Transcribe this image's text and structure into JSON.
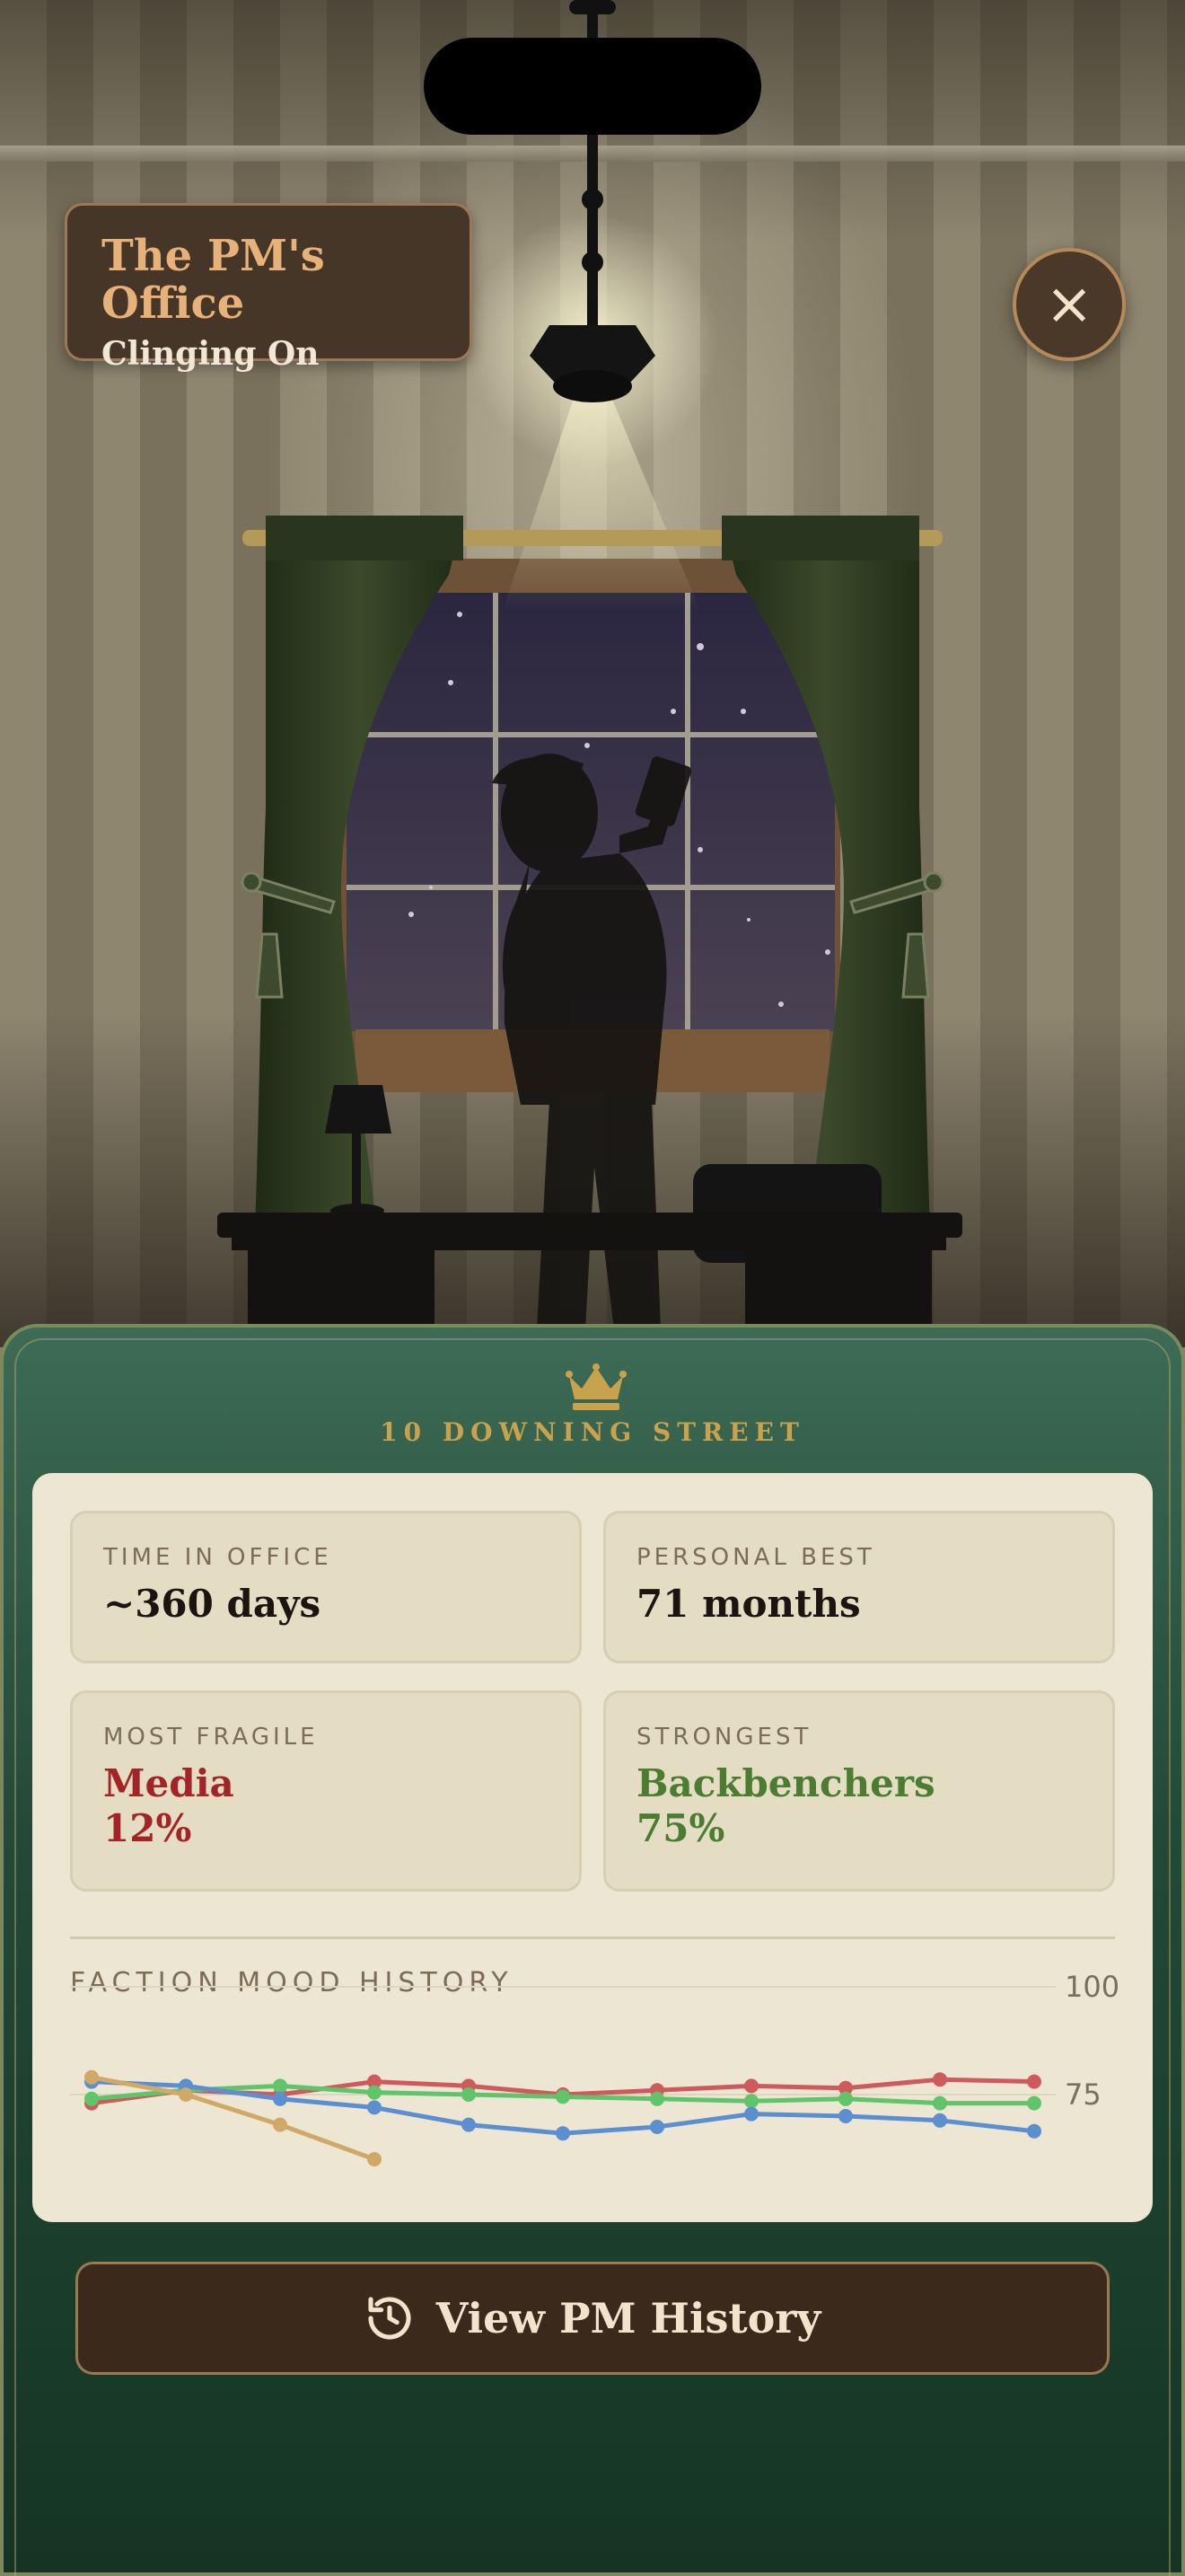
{
  "header": {
    "title": "The PM's Office",
    "subtitle": "Clinging On"
  },
  "close_button": {
    "icon": "close-icon",
    "label": "×"
  },
  "panel": {
    "emblem": "crown-icon",
    "subtitle": "10 DOWNING STREET"
  },
  "stats": {
    "time_in_office": {
      "label": "TIME IN OFFICE",
      "value": "~360 days"
    },
    "personal_best": {
      "label": "PERSONAL BEST",
      "value": "71 months"
    },
    "most_fragile": {
      "label": "MOST FRAGILE",
      "faction": "Media",
      "percent": "12%",
      "color": "#a32426"
    },
    "strongest": {
      "label": "STRONGEST",
      "faction": "Backbenchers",
      "percent": "75%",
      "color": "#4a7d2f"
    }
  },
  "chart_title": "FACTION MOOD HISTORY",
  "chart_data": {
    "type": "line",
    "x": [
      1,
      2,
      3,
      4,
      5,
      6,
      7,
      8,
      9,
      10,
      11
    ],
    "ylim": [
      0,
      100
    ],
    "yticks": [
      "100",
      "75"
    ],
    "grid": true,
    "series": [
      {
        "color": "#cf5a5c",
        "values": [
          73,
          76,
          75,
          78,
          77,
          75,
          76,
          77,
          76.5,
          78.5,
          78
        ]
      },
      {
        "color": "#5fc46a",
        "values": [
          74,
          76,
          77,
          75.5,
          75,
          74.5,
          74,
          73.5,
          74,
          73,
          73
        ]
      },
      {
        "color": "#5b8fd0",
        "values": [
          78,
          77,
          74,
          72,
          68,
          66,
          67.5,
          70.5,
          70,
          69,
          66.5
        ]
      },
      {
        "color": "#d0a868",
        "values": [
          79,
          75,
          68,
          60
        ]
      }
    ]
  },
  "history_button": {
    "icon": "history-icon",
    "label": "View PM History"
  }
}
